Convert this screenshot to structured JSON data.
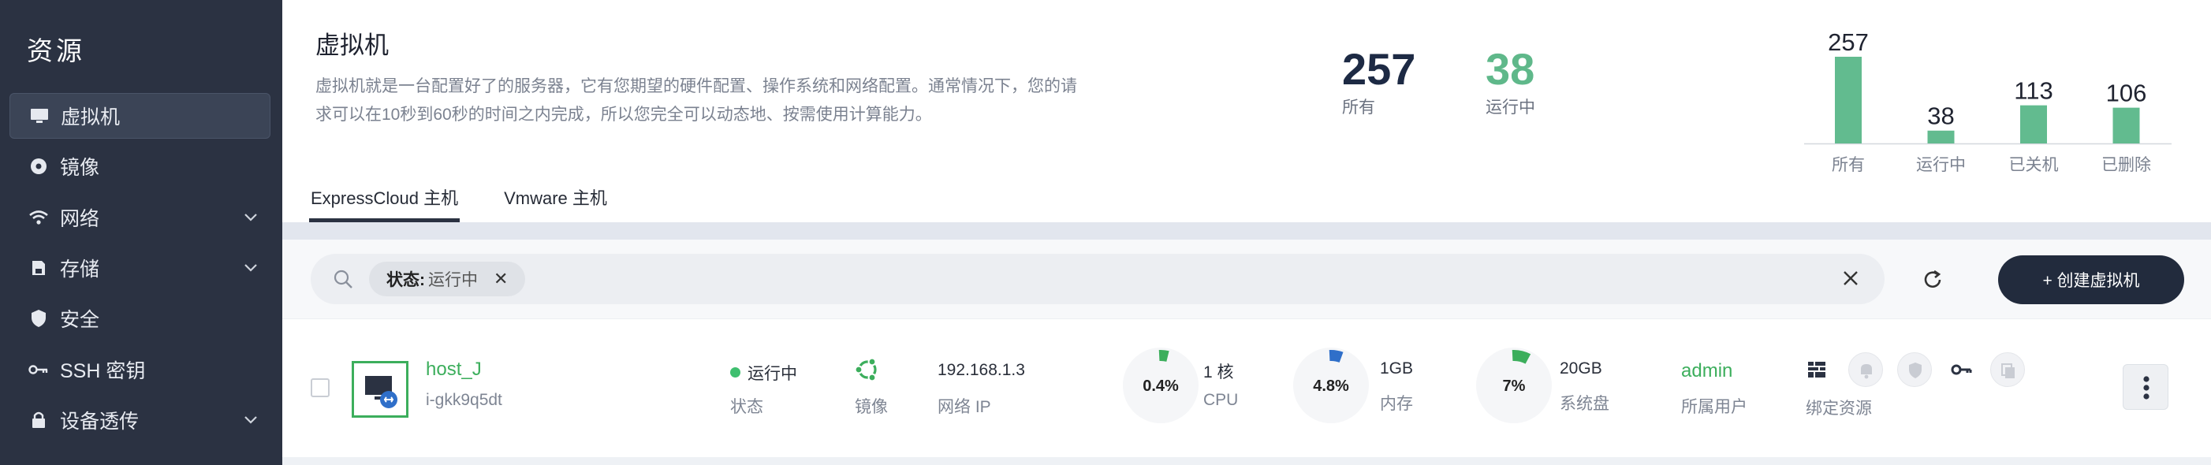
{
  "sidebar": {
    "title": "资源",
    "items": [
      {
        "label": "虚拟机",
        "icon": "monitor-icon",
        "active": true
      },
      {
        "label": "镜像",
        "icon": "disc-icon"
      },
      {
        "label": "网络",
        "icon": "wifi-icon",
        "expandable": true
      },
      {
        "label": "存储",
        "icon": "storage-icon",
        "expandable": true
      },
      {
        "label": "安全",
        "icon": "shield-icon"
      },
      {
        "label": "SSH 密钥",
        "icon": "key-icon"
      },
      {
        "label": "设备透传",
        "icon": "lock-icon",
        "expandable": true
      }
    ]
  },
  "header": {
    "title": "虚拟机",
    "description_line1": "虚拟机就是一台配置好了的服务器，它有您期望的硬件配置、操作系统和网络配置。通常情况下，您的请",
    "description_line2": "求可以在10秒到60秒的时间之内完成，所以您完全可以动态地、按需使用计算能力。",
    "stats": [
      {
        "value": "257",
        "label": "所有",
        "color": "#1d2a44"
      },
      {
        "value": "38",
        "label": "运行中",
        "color": "#5fb88a"
      }
    ]
  },
  "chart_data": {
    "type": "bar",
    "categories": [
      "所有",
      "运行中",
      "已关机",
      "已删除"
    ],
    "values": [
      257,
      38,
      113,
      106
    ],
    "ylim": [
      0,
      257
    ],
    "color": "#62bb8f",
    "title": "",
    "xlabel": "",
    "ylabel": ""
  },
  "tabs": [
    {
      "label": "ExpressCloud 主机",
      "active": true
    },
    {
      "label": "Vmware 主机"
    }
  ],
  "filter": {
    "key": "状态:",
    "value": "运行中"
  },
  "toolbar": {
    "create_label": "+ 创建虚拟机"
  },
  "vm": {
    "name": "host_J",
    "id": "i-gkk9q5dt",
    "status": "运行中",
    "status_label": "状态",
    "status_color": "#3fbf6f",
    "image_label": "镜像",
    "ip": "192.168.1.3",
    "ip_label": "网络 IP",
    "cpu_pct": "0.4%",
    "cpu_value": 0.004,
    "cpu_cores": "1 核",
    "cpu_label": "CPU",
    "mem_pct": "4.8%",
    "mem_value": 0.048,
    "mem_size": "1GB",
    "mem_label": "内存",
    "disk_pct": "7%",
    "disk_value": 0.07,
    "disk_size": "20GB",
    "disk_label": "系统盘",
    "owner": "admin",
    "owner_label": "所属用户",
    "bind_label": "绑定资源",
    "accent_green": "#3cae5c",
    "accent_blue": "#2f6fc9"
  }
}
